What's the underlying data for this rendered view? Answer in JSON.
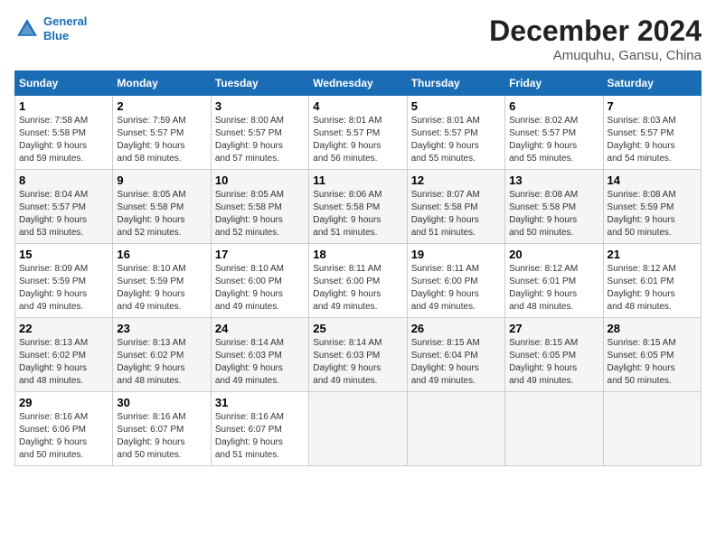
{
  "header": {
    "logo_line1": "General",
    "logo_line2": "Blue",
    "month": "December 2024",
    "location": "Amuquhu, Gansu, China"
  },
  "days_of_week": [
    "Sunday",
    "Monday",
    "Tuesday",
    "Wednesday",
    "Thursday",
    "Friday",
    "Saturday"
  ],
  "weeks": [
    [
      {
        "day": "1",
        "info": "Sunrise: 7:58 AM\nSunset: 5:58 PM\nDaylight: 9 hours\nand 59 minutes."
      },
      {
        "day": "2",
        "info": "Sunrise: 7:59 AM\nSunset: 5:57 PM\nDaylight: 9 hours\nand 58 minutes."
      },
      {
        "day": "3",
        "info": "Sunrise: 8:00 AM\nSunset: 5:57 PM\nDaylight: 9 hours\nand 57 minutes."
      },
      {
        "day": "4",
        "info": "Sunrise: 8:01 AM\nSunset: 5:57 PM\nDaylight: 9 hours\nand 56 minutes."
      },
      {
        "day": "5",
        "info": "Sunrise: 8:01 AM\nSunset: 5:57 PM\nDaylight: 9 hours\nand 55 minutes."
      },
      {
        "day": "6",
        "info": "Sunrise: 8:02 AM\nSunset: 5:57 PM\nDaylight: 9 hours\nand 55 minutes."
      },
      {
        "day": "7",
        "info": "Sunrise: 8:03 AM\nSunset: 5:57 PM\nDaylight: 9 hours\nand 54 minutes."
      }
    ],
    [
      {
        "day": "8",
        "info": "Sunrise: 8:04 AM\nSunset: 5:57 PM\nDaylight: 9 hours\nand 53 minutes."
      },
      {
        "day": "9",
        "info": "Sunrise: 8:05 AM\nSunset: 5:58 PM\nDaylight: 9 hours\nand 52 minutes."
      },
      {
        "day": "10",
        "info": "Sunrise: 8:05 AM\nSunset: 5:58 PM\nDaylight: 9 hours\nand 52 minutes."
      },
      {
        "day": "11",
        "info": "Sunrise: 8:06 AM\nSunset: 5:58 PM\nDaylight: 9 hours\nand 51 minutes."
      },
      {
        "day": "12",
        "info": "Sunrise: 8:07 AM\nSunset: 5:58 PM\nDaylight: 9 hours\nand 51 minutes."
      },
      {
        "day": "13",
        "info": "Sunrise: 8:08 AM\nSunset: 5:58 PM\nDaylight: 9 hours\nand 50 minutes."
      },
      {
        "day": "14",
        "info": "Sunrise: 8:08 AM\nSunset: 5:59 PM\nDaylight: 9 hours\nand 50 minutes."
      }
    ],
    [
      {
        "day": "15",
        "info": "Sunrise: 8:09 AM\nSunset: 5:59 PM\nDaylight: 9 hours\nand 49 minutes."
      },
      {
        "day": "16",
        "info": "Sunrise: 8:10 AM\nSunset: 5:59 PM\nDaylight: 9 hours\nand 49 minutes."
      },
      {
        "day": "17",
        "info": "Sunrise: 8:10 AM\nSunset: 6:00 PM\nDaylight: 9 hours\nand 49 minutes."
      },
      {
        "day": "18",
        "info": "Sunrise: 8:11 AM\nSunset: 6:00 PM\nDaylight: 9 hours\nand 49 minutes."
      },
      {
        "day": "19",
        "info": "Sunrise: 8:11 AM\nSunset: 6:00 PM\nDaylight: 9 hours\nand 49 minutes."
      },
      {
        "day": "20",
        "info": "Sunrise: 8:12 AM\nSunset: 6:01 PM\nDaylight: 9 hours\nand 48 minutes."
      },
      {
        "day": "21",
        "info": "Sunrise: 8:12 AM\nSunset: 6:01 PM\nDaylight: 9 hours\nand 48 minutes."
      }
    ],
    [
      {
        "day": "22",
        "info": "Sunrise: 8:13 AM\nSunset: 6:02 PM\nDaylight: 9 hours\nand 48 minutes."
      },
      {
        "day": "23",
        "info": "Sunrise: 8:13 AM\nSunset: 6:02 PM\nDaylight: 9 hours\nand 48 minutes."
      },
      {
        "day": "24",
        "info": "Sunrise: 8:14 AM\nSunset: 6:03 PM\nDaylight: 9 hours\nand 49 minutes."
      },
      {
        "day": "25",
        "info": "Sunrise: 8:14 AM\nSunset: 6:03 PM\nDaylight: 9 hours\nand 49 minutes."
      },
      {
        "day": "26",
        "info": "Sunrise: 8:15 AM\nSunset: 6:04 PM\nDaylight: 9 hours\nand 49 minutes."
      },
      {
        "day": "27",
        "info": "Sunrise: 8:15 AM\nSunset: 6:05 PM\nDaylight: 9 hours\nand 49 minutes."
      },
      {
        "day": "28",
        "info": "Sunrise: 8:15 AM\nSunset: 6:05 PM\nDaylight: 9 hours\nand 50 minutes."
      }
    ],
    [
      {
        "day": "29",
        "info": "Sunrise: 8:16 AM\nSunset: 6:06 PM\nDaylight: 9 hours\nand 50 minutes."
      },
      {
        "day": "30",
        "info": "Sunrise: 8:16 AM\nSunset: 6:07 PM\nDaylight: 9 hours\nand 50 minutes."
      },
      {
        "day": "31",
        "info": "Sunrise: 8:16 AM\nSunset: 6:07 PM\nDaylight: 9 hours\nand 51 minutes."
      },
      null,
      null,
      null,
      null
    ]
  ]
}
